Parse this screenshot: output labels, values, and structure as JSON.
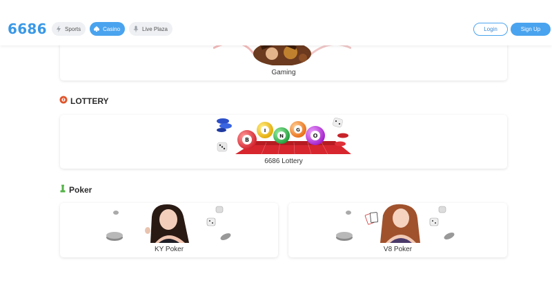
{
  "header": {
    "logo": "6686",
    "nav": [
      {
        "label": "Sports",
        "icon": "lightning-icon",
        "active": false
      },
      {
        "label": "Casino",
        "icon": "spade-icon",
        "active": true
      },
      {
        "label": "Live Plaza",
        "icon": "microphone-icon",
        "active": false
      }
    ],
    "login_label": "Login",
    "signup_label": "Sign Up"
  },
  "gaming": {
    "label": "Gaming"
  },
  "lottery": {
    "title": "LOTTERY",
    "icon": "lottery-ball-icon",
    "card_label": "6686 Lottery",
    "balls": [
      "B",
      "I",
      "N",
      "G",
      "O"
    ]
  },
  "poker": {
    "title": "Poker",
    "icon": "chess-piece-icon",
    "cards": [
      {
        "label": "KY Poker"
      },
      {
        "label": "V8 Poker"
      }
    ]
  },
  "colors": {
    "brand": "#3a98e6",
    "accent": "#4aa3ee",
    "lottery_icon": "#e0542a",
    "poker_icon": "#56b24a"
  }
}
